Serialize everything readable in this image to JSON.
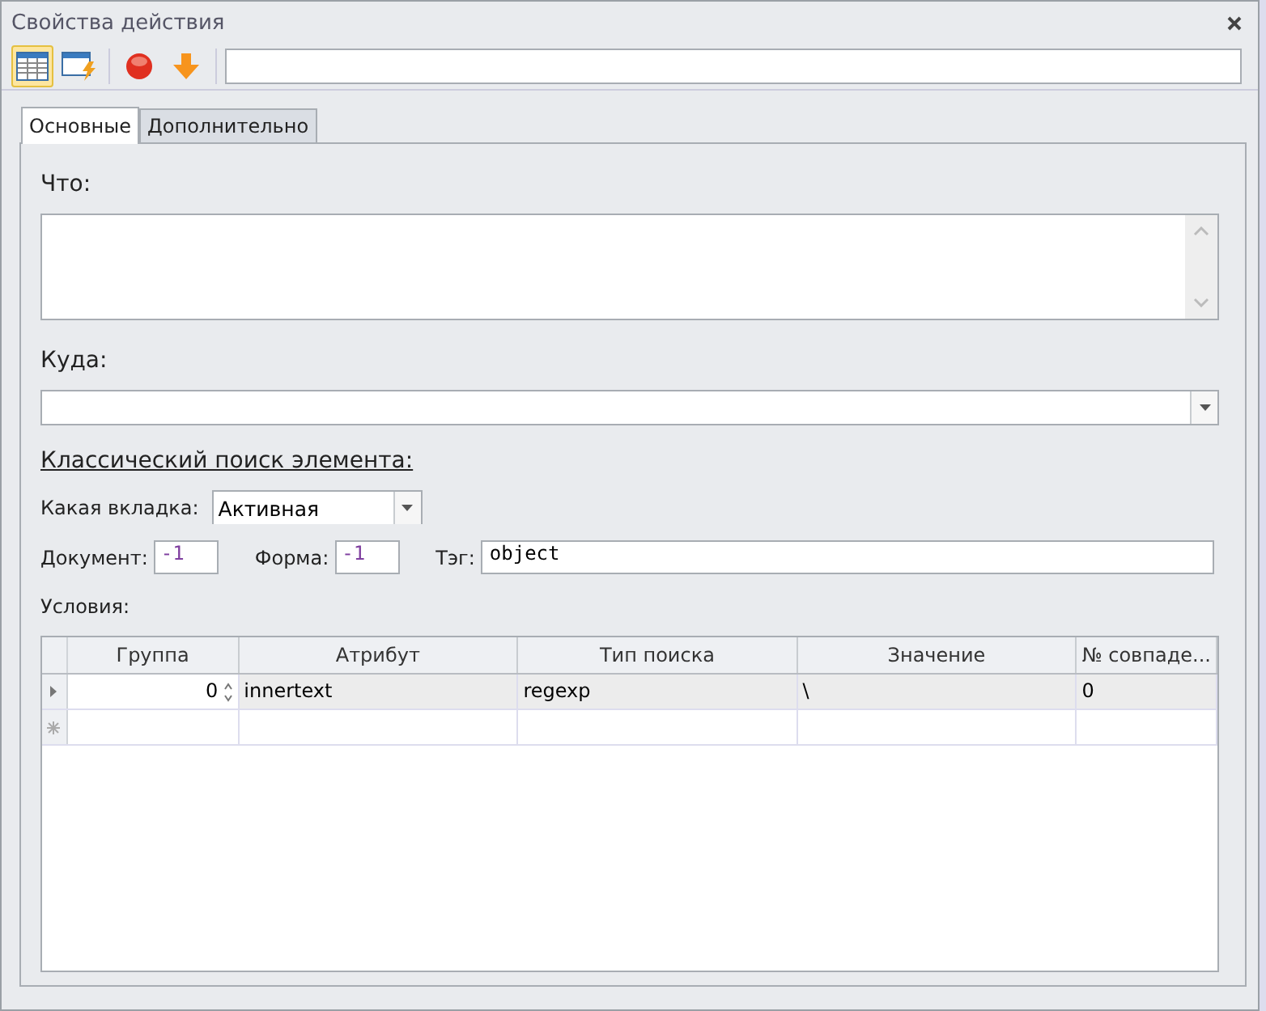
{
  "window": {
    "title": "Свойства действия"
  },
  "toolbar": {
    "buttons": [
      {
        "kind": "grid",
        "selected": true
      },
      {
        "kind": "window",
        "selected": false
      },
      {
        "kind": "stop",
        "selected": false
      },
      {
        "kind": "down",
        "selected": false
      }
    ]
  },
  "tabs": [
    {
      "label": "Основные",
      "selected": true
    },
    {
      "label": "Дополнительно",
      "selected": false
    }
  ],
  "what": {
    "label": "Что:"
  },
  "where": {
    "label": "Куда:"
  },
  "classic_search": {
    "title": "Классический поиск элемента:"
  },
  "which_tab": {
    "label": "Какая вкладка:",
    "value": "Активная"
  },
  "document": {
    "label": "Документ:",
    "value": "-1"
  },
  "form": {
    "label": "Форма:",
    "value": "-1"
  },
  "tag": {
    "label": "Тэг:",
    "value": "object"
  },
  "conditions": {
    "label": "Условия:",
    "columns": [
      "Группа",
      "Атрибут",
      "Тип поиска",
      "Значение",
      "№ совпаде..."
    ],
    "rows": [
      {
        "kind": "current",
        "selected": true,
        "cells": [
          "0",
          "innertext",
          "regexp",
          "\\",
          "0"
        ]
      },
      {
        "kind": "new",
        "selected": false,
        "cells": []
      }
    ]
  }
}
